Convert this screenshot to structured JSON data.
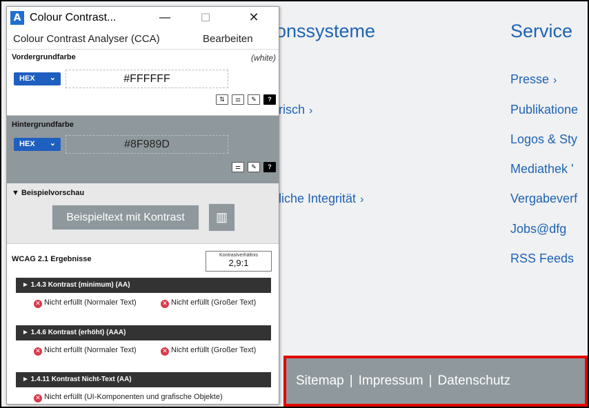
{
  "background_page": {
    "heading_left": "ionssysteme",
    "heading_right": "Service",
    "left_links": [
      {
        "label": "brisch",
        "chevron": "›"
      },
      {
        "label": "ftliche Integrität",
        "chevron": "›"
      }
    ],
    "service_links": [
      {
        "label": "Presse",
        "chevron": "›"
      },
      {
        "label": "Publikatione"
      },
      {
        "label": "Logos & Sty"
      },
      {
        "label": "Mediathek '"
      },
      {
        "label": "Vergabeverf"
      },
      {
        "label": "Jobs@dfg"
      },
      {
        "label": "RSS Feeds"
      }
    ],
    "footer": {
      "links": [
        "Sitemap",
        "Impressum",
        "Datenschutz"
      ],
      "separator": "|",
      "bg_color": "#8f989d",
      "highlight_color": "#e10600"
    },
    "link_color": "#1e63b5"
  },
  "cca": {
    "window_title": "Colour Contrast...",
    "app_icon": "contrast-app-icon",
    "window_controls": {
      "minimize": "—",
      "maximize": "☐",
      "close": "✕"
    },
    "menu": [
      "Colour Contrast Analyser (CCA)",
      "Bearbeiten"
    ],
    "foreground": {
      "label": "Vordergrundfarbe",
      "note": "(white)",
      "format": "HEX",
      "format_caret": "⌄",
      "value": "#FFFFFF",
      "tools": [
        {
          "icon": "swap-icon",
          "glyph": "⇅"
        },
        {
          "icon": "sliders-icon",
          "glyph": "⚌"
        },
        {
          "icon": "eyedropper-icon",
          "glyph": "✎"
        },
        {
          "icon": "help-icon",
          "glyph": "?"
        }
      ]
    },
    "background": {
      "label": "Hintergrundfarbe",
      "format": "HEX",
      "format_caret": "⌄",
      "value": "#8F989D",
      "tools": [
        {
          "icon": "sliders-icon",
          "glyph": "⚌"
        },
        {
          "icon": "eyedropper-icon",
          "glyph": "✎"
        },
        {
          "icon": "help-icon",
          "glyph": "?"
        }
      ]
    },
    "preview": {
      "label": "▼ Beispielvorschau",
      "sample_text": "Beispieltext mit Kontrast",
      "chart_button_icon": "chart-icon",
      "chart_glyph": "▥"
    },
    "wcag": {
      "label": "WCAG 2.1 Ergebnisse",
      "ratio_label": "Kontrastverhältnis",
      "ratio_value": "2,9:1",
      "fail_glyph": "✕",
      "criteria": [
        {
          "title": "► 1.4.3 Kontrast (minimum) (AA)",
          "results": [
            "Nicht erfüllt (Normaler Text)",
            "Nicht erfüllt (Großer Text)"
          ]
        },
        {
          "title": "► 1.4.6 Kontrast (erhöht) (AAA)",
          "results": [
            "Nicht erfüllt (Normaler Text)",
            "Nicht erfüllt (Großer Text)"
          ]
        },
        {
          "title": "► 1.4.11 Kontrast Nicht-Text (AA)",
          "results": [
            "Nicht erfüllt (UI-Komponenten und grafische Objekte)"
          ]
        }
      ]
    }
  }
}
